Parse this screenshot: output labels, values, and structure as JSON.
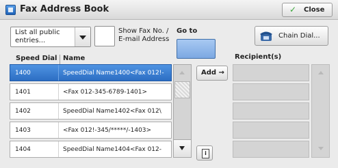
{
  "window": {
    "title": "Fax Address Book",
    "close_label": "Close"
  },
  "controls": {
    "list_all_label": "List all public entries...",
    "show_fax_label_line1": "Show Fax No. /",
    "show_fax_label_line2": "E-mail Address",
    "goto_label": "Go to",
    "goto_value": "",
    "chain_dial_label": "Chain Dial...",
    "add_label": "Add →"
  },
  "table": {
    "columns": [
      "Speed Dial",
      "Name"
    ],
    "rows": [
      {
        "speed_dial": "1400",
        "name": "SpeedDial Name1400<Fax 012!-",
        "selected": true
      },
      {
        "speed_dial": "1401",
        "name": "<Fax 012-345-6789-1401>",
        "selected": false
      },
      {
        "speed_dial": "1402",
        "name": "SpeedDial Name1402<Fax 012\\",
        "selected": false
      },
      {
        "speed_dial": "1403",
        "name": "<Fax 012!-345/*****/-1403>",
        "selected": false
      },
      {
        "speed_dial": "1404",
        "name": "SpeedDial Name1404<Fax 012-",
        "selected": false
      }
    ]
  },
  "recipients": {
    "label": "Recipient(s)"
  },
  "colors": {
    "selected_row": "#2c6ec3",
    "goto_field": "#7ca8e2"
  }
}
